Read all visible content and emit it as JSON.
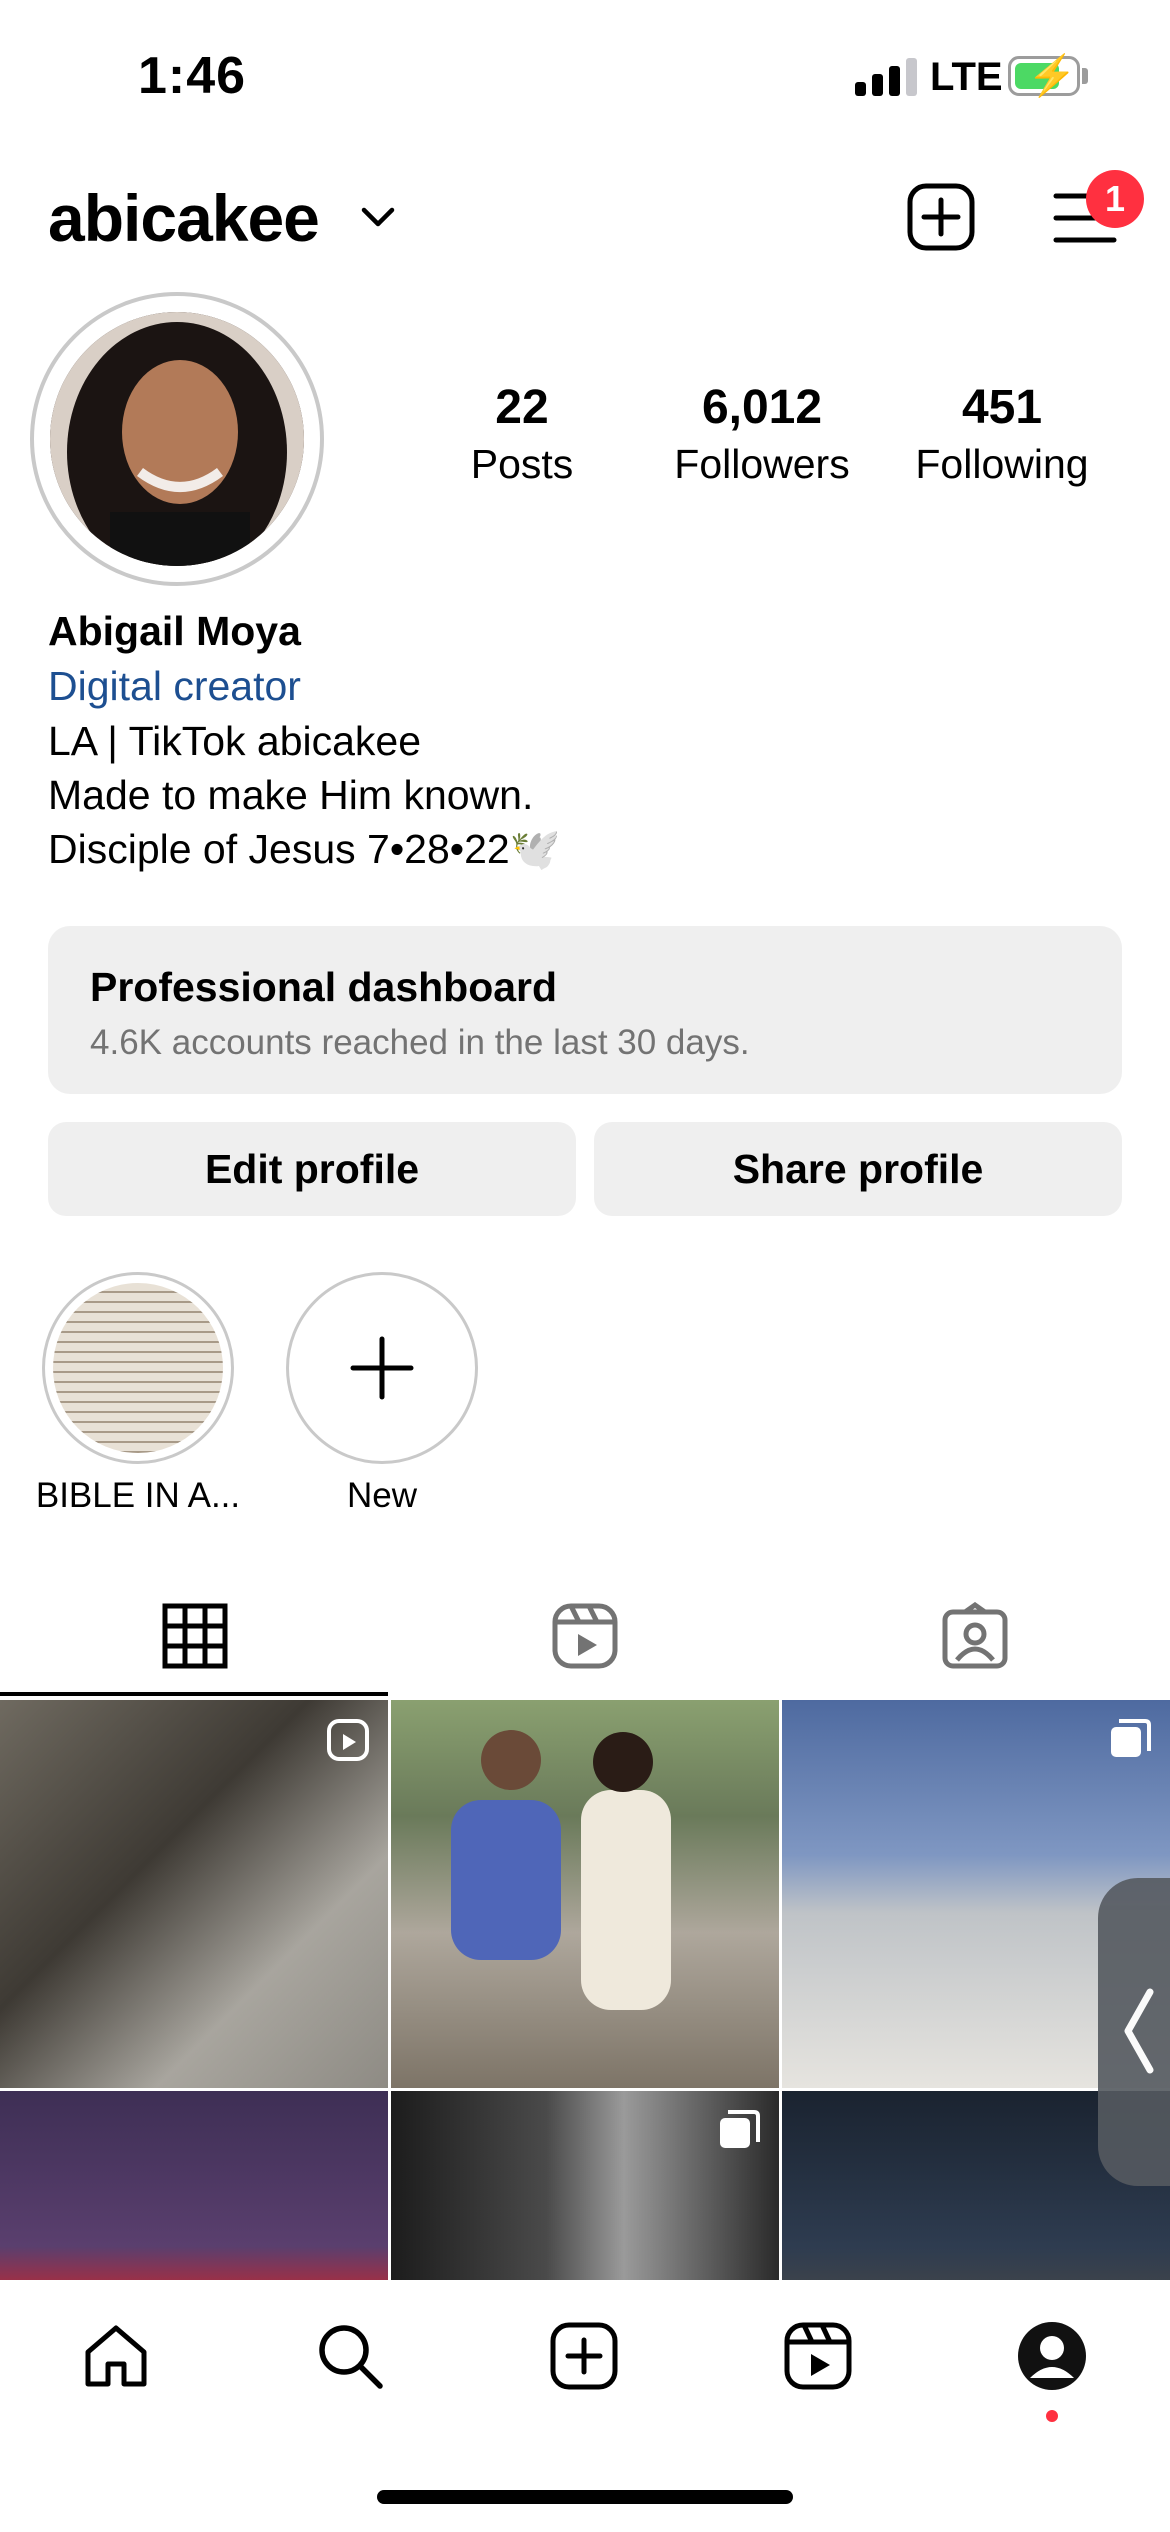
{
  "status_bar": {
    "time": "1:46",
    "network": "LTE",
    "signal_bars_active": 3,
    "signal_bars_total": 4,
    "battery_charging": true
  },
  "header": {
    "username": "abicakee",
    "icons": [
      "chevron-down-icon",
      "add-post-icon",
      "menu-icon"
    ],
    "notification_badge": "1"
  },
  "profile": {
    "stats": [
      {
        "value": "22",
        "label": "Posts"
      },
      {
        "value": "6,012",
        "label": "Followers"
      },
      {
        "value": "451",
        "label": "Following"
      }
    ]
  },
  "bio": {
    "name": "Abigail Moya",
    "category": "Digital creator",
    "lines": [
      "LA | TikTok abicakee",
      "Made to make Him known.",
      "Disciple of Jesus 7•28•22🕊️"
    ]
  },
  "dashboard": {
    "title": "Professional dashboard",
    "subtitle": "4.6K accounts reached in the last 30 days."
  },
  "buttons": {
    "edit": "Edit profile",
    "share": "Share profile"
  },
  "highlights": [
    {
      "label": "BIBLE IN A..."
    },
    {
      "label": "New"
    }
  ],
  "tabs": [
    {
      "icon": "grid-icon",
      "active": true
    },
    {
      "icon": "reels-icon",
      "active": false
    },
    {
      "icon": "tagged-icon",
      "active": false
    }
  ],
  "bottom_nav": [
    "home-icon",
    "search-icon",
    "create-icon",
    "reels-icon",
    "profile-icon"
  ],
  "colors": {
    "accent_link": "#1d4f91",
    "badge": "#ff3040",
    "button_bg": "#efefef",
    "battery": "#4cd964"
  }
}
